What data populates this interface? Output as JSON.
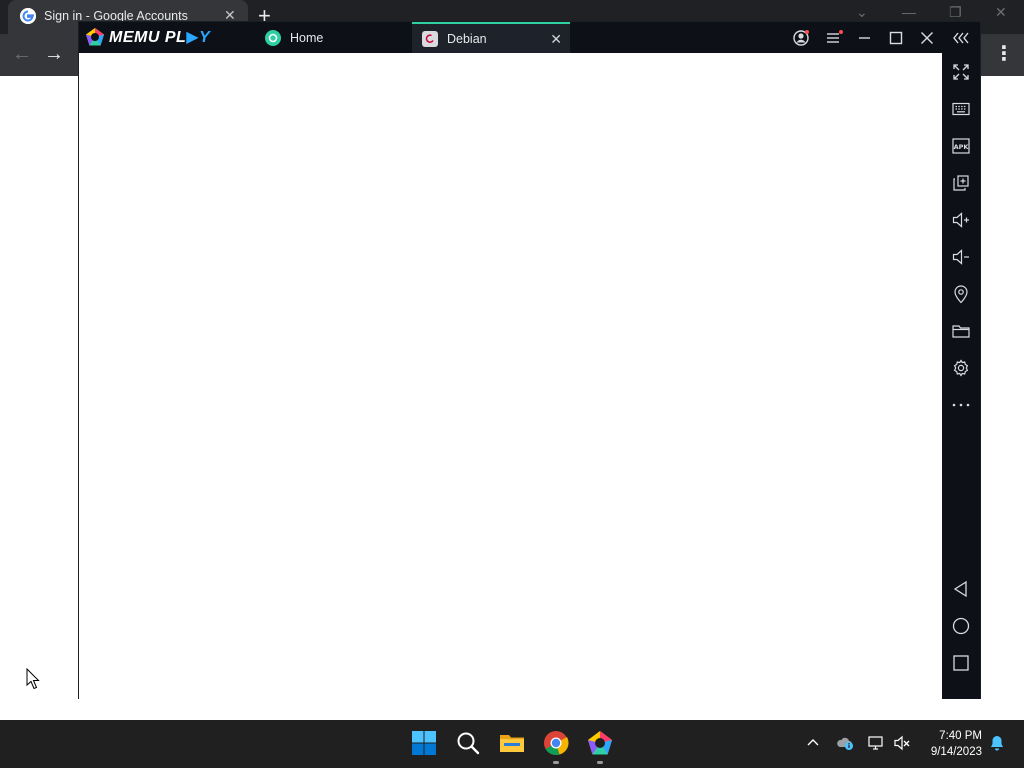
{
  "chrome": {
    "tab_title": "Sign in - Google Accounts",
    "tab_close": "✕",
    "new_tab": "+",
    "back": "←",
    "forward": "→",
    "menu": "⋮",
    "minimize": "—",
    "restore": "❐",
    "close": "✕",
    "tab_search": "⌄"
  },
  "memu": {
    "logo_text_main": "MEMU PL",
    "logo_text_accent": "▶Y",
    "tabs": [
      {
        "label": "Home",
        "active": false
      },
      {
        "label": "Debian",
        "active": true,
        "close": "✕"
      }
    ],
    "titlebar_buttons": [
      "account-icon",
      "menu-icon",
      "minimize-icon",
      "maximize-icon",
      "close-icon",
      "collapse-sidebar-icon"
    ],
    "sidebar_tools": [
      "fullscreen-icon",
      "keyboard-icon",
      "apk-install-icon",
      "multi-instance-icon",
      "volume-up-icon",
      "volume-down-icon",
      "location-icon",
      "shared-folder-icon",
      "settings-icon",
      "more-icon"
    ],
    "sidebar_nav": [
      "back-icon",
      "home-icon",
      "recents-icon"
    ],
    "accent_color": "#2ecfa3",
    "notification_color": "#ff4d4f"
  },
  "taskbar": {
    "apps": [
      "windows-start-icon",
      "search-icon",
      "file-explorer-icon",
      "chrome-icon",
      "memu-icon"
    ],
    "tray": [
      "show-hidden-icons-chevron",
      "onedrive-icon",
      "network-icon",
      "volume-muted-icon",
      "notification-bell-icon"
    ],
    "time": "7:40 PM",
    "date": "9/14/2023"
  }
}
